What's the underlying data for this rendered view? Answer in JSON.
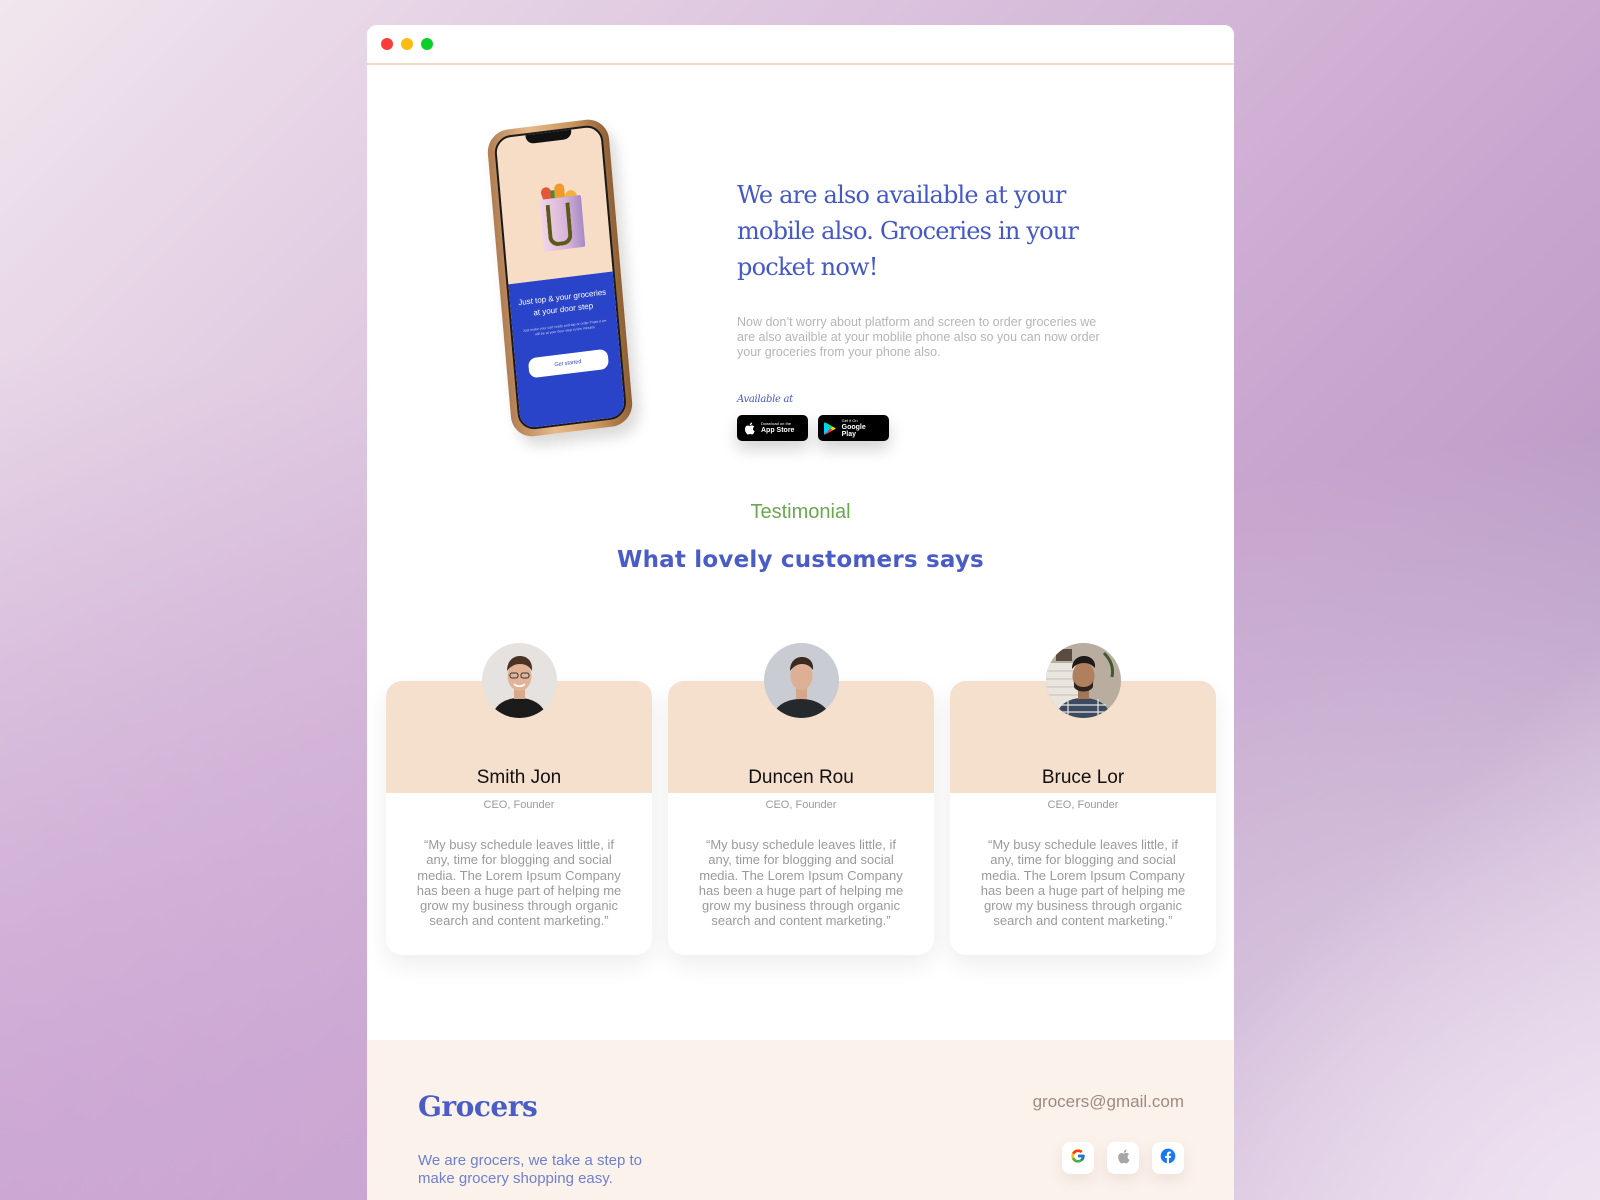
{
  "window": {
    "controls": [
      "close",
      "minimize",
      "maximize"
    ]
  },
  "hero": {
    "title": "We are also available at your mobile also. Groceries in your pocket now!",
    "description": "Now don’t worry about platform and screen to order groceries we are also availble at your moblile phone also so you can now order your groceries from your phone also.",
    "available_label": "Available at",
    "phone_screen": {
      "title": "Just top & your groceries at your door step",
      "subtitle": "Just make your cart ready and tap or order Thats it we will be at your door step in few minutes",
      "button": "Get started"
    },
    "store_buttons": [
      {
        "icon": "apple-icon",
        "small": "Download on the",
        "big": "App Store"
      },
      {
        "icon": "google-play-icon",
        "small": "Get it On",
        "big": "Google Play"
      }
    ]
  },
  "testimonial": {
    "label": "Testimonial",
    "heading": "What lovely customers says",
    "cards": [
      {
        "name": "Smith Jon",
        "role": "CEO, Founder",
        "quote": "“My busy schedule leaves little, if any, time for blogging and social media. The Lorem Ipsum Company has been a huge part of helping me grow my business through organic search and content marketing.”"
      },
      {
        "name": "Duncen Rou",
        "role": "CEO, Founder",
        "quote": "“My busy schedule leaves little, if any, time for blogging and social media. The Lorem Ipsum Company has been a huge part of helping me grow my business through organic search and content marketing.”"
      },
      {
        "name": "Bruce Lor",
        "role": "CEO, Founder",
        "quote": "“My busy schedule leaves little, if any, time for blogging and social media. The Lorem Ipsum Company has been a huge part of helping me grow my business through organic search and content marketing.”"
      }
    ]
  },
  "footer": {
    "logo": "Grocers",
    "tagline": "We are grocers, we take a step to make grocery shopping easy.",
    "email": "grocers@gmail.com",
    "socials": [
      "google-icon",
      "apple-icon",
      "facebook-icon"
    ]
  },
  "colors": {
    "brand_blue": "#4a5cc6",
    "accent_green": "#6aa84f",
    "card_peach": "#f5dfcd",
    "footer_bg": "#fbf2ec"
  }
}
